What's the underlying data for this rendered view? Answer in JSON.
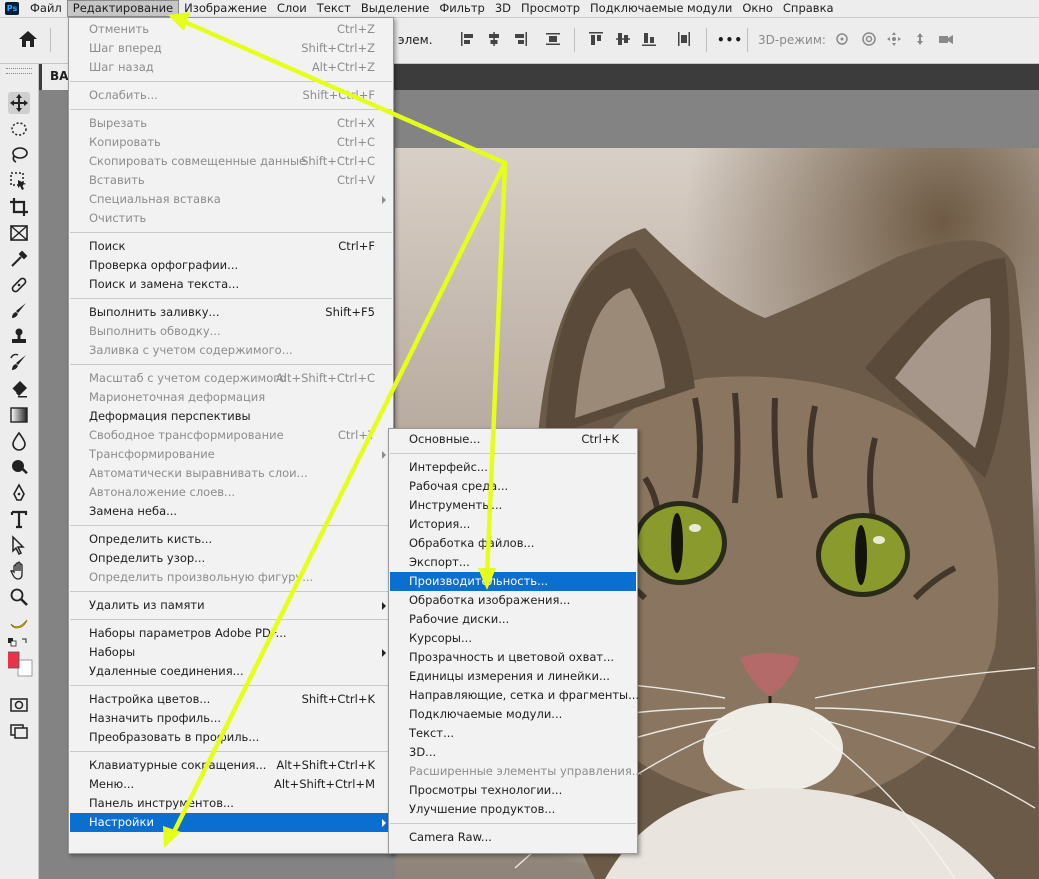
{
  "menubar": {
    "logo": "Ps",
    "items": [
      "Файл",
      "Редактирование",
      "Изображение",
      "Слои",
      "Текст",
      "Выделение",
      "Фильтр",
      "3D",
      "Просмотр",
      "Подключаемые модули",
      "Окно",
      "Справка"
    ]
  },
  "optionsbar": {
    "layers_text": "элем.",
    "mode_3d_label": "3D-режим:"
  },
  "document": {
    "tab_title": "BA"
  },
  "edit_menu": {
    "items": [
      {
        "label": "Отменить",
        "shortcut": "Ctrl+Z",
        "disabled": true
      },
      {
        "label": "Шаг вперед",
        "shortcut": "Shift+Ctrl+Z",
        "disabled": true
      },
      {
        "label": "Шаг назад",
        "shortcut": "Alt+Ctrl+Z",
        "disabled": true
      },
      {
        "sep": true
      },
      {
        "label": "Ослабить...",
        "shortcut": "Shift+Ctrl+F",
        "disabled": true
      },
      {
        "sep": true
      },
      {
        "label": "Вырезать",
        "shortcut": "Ctrl+X",
        "disabled": true
      },
      {
        "label": "Копировать",
        "shortcut": "Ctrl+C",
        "disabled": true
      },
      {
        "label": "Скопировать совмещенные данные",
        "shortcut": "Shift+Ctrl+C",
        "disabled": true
      },
      {
        "label": "Вставить",
        "shortcut": "Ctrl+V",
        "disabled": true
      },
      {
        "label": "Специальная вставка",
        "shortcut": "",
        "disabled": true,
        "submenu": true
      },
      {
        "label": "Очистить",
        "shortcut": "",
        "disabled": true
      },
      {
        "sep": true
      },
      {
        "label": "Поиск",
        "shortcut": "Ctrl+F",
        "disabled": false
      },
      {
        "label": "Проверка орфографии...",
        "shortcut": "",
        "disabled": false
      },
      {
        "label": "Поиск и замена текста...",
        "shortcut": "",
        "disabled": false
      },
      {
        "sep": true
      },
      {
        "label": "Выполнить заливку...",
        "shortcut": "Shift+F5",
        "disabled": false
      },
      {
        "label": "Выполнить обводку...",
        "shortcut": "",
        "disabled": true
      },
      {
        "label": "Заливка с учетом содержимого...",
        "shortcut": "",
        "disabled": true
      },
      {
        "sep": true
      },
      {
        "label": "Масштаб с учетом содержимого",
        "shortcut": "Alt+Shift+Ctrl+C",
        "disabled": true
      },
      {
        "label": "Марионеточная деформация",
        "shortcut": "",
        "disabled": true
      },
      {
        "label": "Деформация перспективы",
        "shortcut": "",
        "disabled": false
      },
      {
        "label": "Свободное трансформирование",
        "shortcut": "Ctrl+T",
        "disabled": true
      },
      {
        "label": "Трансформирование",
        "shortcut": "",
        "disabled": true,
        "submenu": true
      },
      {
        "label": "Автоматически выравнивать слои...",
        "shortcut": "",
        "disabled": true
      },
      {
        "label": "Автоналожение слоев...",
        "shortcut": "",
        "disabled": true
      },
      {
        "label": "Замена неба...",
        "shortcut": "",
        "disabled": false
      },
      {
        "sep": true
      },
      {
        "label": "Определить кисть...",
        "shortcut": "",
        "disabled": false
      },
      {
        "label": "Определить узор...",
        "shortcut": "",
        "disabled": false
      },
      {
        "label": "Определить произвольную фигуру...",
        "shortcut": "",
        "disabled": true
      },
      {
        "sep": true
      },
      {
        "label": "Удалить из памяти",
        "shortcut": "",
        "disabled": false,
        "submenu": true
      },
      {
        "sep": true
      },
      {
        "label": "Наборы параметров Adobe PDF...",
        "shortcut": "",
        "disabled": false
      },
      {
        "label": "Наборы",
        "shortcut": "",
        "disabled": false,
        "submenu": true
      },
      {
        "label": "Удаленные соединения...",
        "shortcut": "",
        "disabled": false
      },
      {
        "sep": true
      },
      {
        "label": "Настройка цветов...",
        "shortcut": "Shift+Ctrl+K",
        "disabled": false
      },
      {
        "label": "Назначить профиль...",
        "shortcut": "",
        "disabled": false
      },
      {
        "label": "Преобразовать в профиль...",
        "shortcut": "",
        "disabled": false
      },
      {
        "sep": true
      },
      {
        "label": "Клавиатурные сокращения...",
        "shortcut": "Alt+Shift+Ctrl+K",
        "disabled": false
      },
      {
        "label": "Меню...",
        "shortcut": "Alt+Shift+Ctrl+M",
        "disabled": false
      },
      {
        "label": "Панель инструментов...",
        "shortcut": "",
        "disabled": false
      },
      {
        "label": "Настройки",
        "shortcut": "",
        "disabled": false,
        "submenu": true,
        "highlighted": true
      }
    ]
  },
  "prefs_submenu": {
    "items": [
      {
        "label": "Основные...",
        "shortcut": "Ctrl+K",
        "disabled": false
      },
      {
        "sep": true
      },
      {
        "label": "Интерфейс...",
        "shortcut": "",
        "disabled": false
      },
      {
        "label": "Рабочая среда...",
        "shortcut": "",
        "disabled": false
      },
      {
        "label": "Инструменты...",
        "shortcut": "",
        "disabled": false
      },
      {
        "label": "История...",
        "shortcut": "",
        "disabled": false
      },
      {
        "label": "Обработка файлов...",
        "shortcut": "",
        "disabled": false
      },
      {
        "label": "Экспорт...",
        "shortcut": "",
        "disabled": false
      },
      {
        "label": "Производительность...",
        "shortcut": "",
        "disabled": false,
        "highlighted": true
      },
      {
        "label": "Обработка изображения...",
        "shortcut": "",
        "disabled": false
      },
      {
        "label": "Рабочие диски...",
        "shortcut": "",
        "disabled": false
      },
      {
        "label": "Курсоры...",
        "shortcut": "",
        "disabled": false
      },
      {
        "label": "Прозрачность и цветовой охват...",
        "shortcut": "",
        "disabled": false
      },
      {
        "label": "Единицы измерения и линейки...",
        "shortcut": "",
        "disabled": false
      },
      {
        "label": "Направляющие, сетка и фрагменты...",
        "shortcut": "",
        "disabled": false
      },
      {
        "label": "Подключаемые модули...",
        "shortcut": "",
        "disabled": false
      },
      {
        "label": "Текст...",
        "shortcut": "",
        "disabled": false
      },
      {
        "label": "3D...",
        "shortcut": "",
        "disabled": false
      },
      {
        "label": "Расширенные элементы управления...",
        "shortcut": "",
        "disabled": true
      },
      {
        "label": "Просмотры технологии...",
        "shortcut": "",
        "disabled": false
      },
      {
        "label": "Улучшение продуктов...",
        "shortcut": "",
        "disabled": false
      },
      {
        "sep": true
      },
      {
        "label": "Camera Raw...",
        "shortcut": "",
        "disabled": false
      }
    ]
  },
  "tools": [
    "move-tool",
    "marquee-tool",
    "lasso-tool",
    "object-select-tool",
    "crop-tool",
    "frame-tool",
    "eyedropper-tool",
    "healing-tool",
    "brush-tool",
    "stamp-tool",
    "history-brush-tool",
    "eraser-tool",
    "gradient-tool",
    "blur-tool",
    "dodge-tool",
    "pen-tool",
    "type-tool",
    "path-select-tool",
    "hand-tool",
    "zoom-tool",
    "banana-tool",
    "color-swatches",
    "quick-mask",
    "screen-mode"
  ],
  "colors": {
    "menu_highlight": "#0a6fd1",
    "annotation_arrow": "#e6ff1a",
    "foreground_color": "#e8334a",
    "background_color": "#ffffff"
  }
}
